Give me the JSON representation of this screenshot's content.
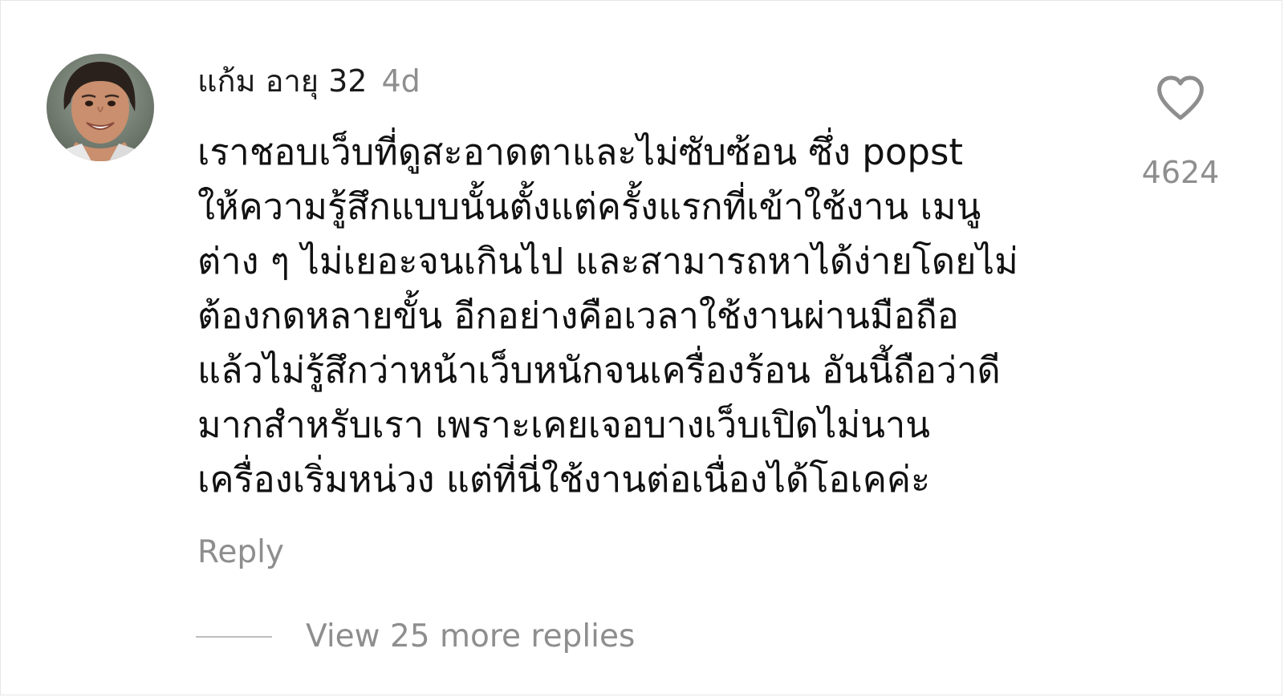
{
  "comment": {
    "username": "แก้ม อายุ 32",
    "time_ago": "4d",
    "text_lines": [
      "เราชอบเว็บที่ดูสะอาดตาและไม่ซับซ้อน ซึ่ง popst",
      "ให้ความรู้สึกแบบนั้นตั้งแต่ครั้งแรกที่เข้าใช้งาน เมนู",
      "ต่าง ๆ ไม่เยอะจนเกินไป และสามารถหาได้ง่ายโดยไม่",
      "ต้องกดหลายขั้น อีกอย่างคือเวลาใช้งานผ่านมือถือ",
      "แล้วไม่รู้สึกว่าหน้าเว็บหนักจนเครื่องร้อน อันนี้ถือว่าดี",
      "มากสำหรับเรา เพราะเคยเจอบางเว็บเปิดไม่นาน",
      "เครื่องเริ่มหน่วง แต่ที่นี่ใช้งานต่อเนื่องได้โอเคค่ะ"
    ],
    "reply_label": "Reply",
    "view_more_replies_label": "View 25 more replies",
    "like_count": "4624",
    "avatar_icon": "user-avatar-photo",
    "like_icon": "heart-outline-icon"
  },
  "colors": {
    "primary_text": "#111111",
    "secondary_text": "#8e8e8e",
    "divider": "#bdbdbd",
    "background": "#ffffff"
  }
}
